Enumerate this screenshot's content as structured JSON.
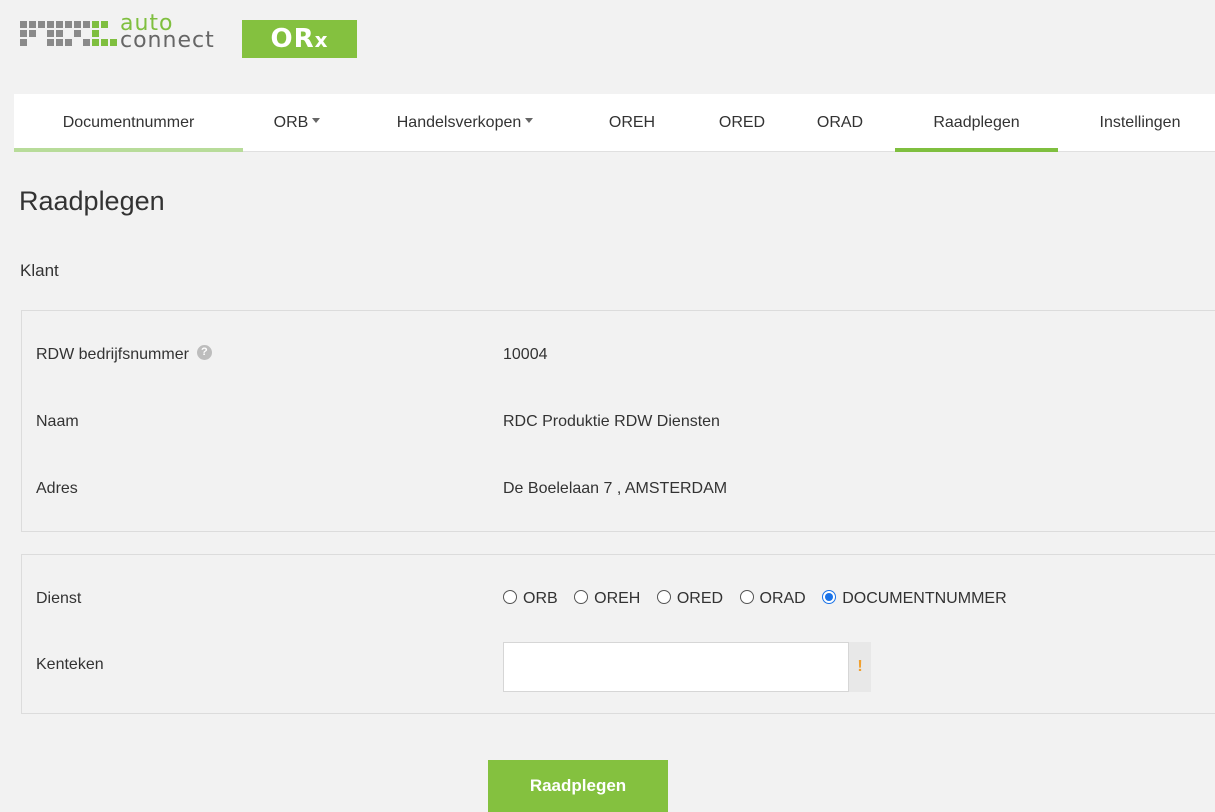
{
  "brand": {
    "logo_line1": "auto",
    "logo_line2": "connect",
    "badge_main": "OR",
    "badge_sub": "x",
    "accent_color": "#84c13f"
  },
  "nav": {
    "items": [
      {
        "label": "Documentnummer",
        "dropdown": false
      },
      {
        "label": "ORB",
        "dropdown": true
      },
      {
        "label": "Handelsverkopen",
        "dropdown": true
      },
      {
        "label": "OREH",
        "dropdown": false
      },
      {
        "label": "ORED",
        "dropdown": false
      },
      {
        "label": "ORAD",
        "dropdown": false
      },
      {
        "label": "Raadplegen",
        "dropdown": false,
        "active": true
      },
      {
        "label": "Instellingen",
        "dropdown": false
      }
    ]
  },
  "page": {
    "title": "Raadplegen",
    "section_title": "Klant"
  },
  "klant": {
    "rdw_label": "RDW bedrijfsnummer",
    "rdw_help_icon": "question-circle-icon",
    "rdw_value": "10004",
    "naam_label": "Naam",
    "naam_value": "RDC Produktie RDW Diensten",
    "adres_label": "Adres",
    "adres_value": "De Boelelaan 7 , AMSTERDAM"
  },
  "form": {
    "dienst_label": "Dienst",
    "dienst_options": [
      "ORB",
      "OREH",
      "ORED",
      "ORAD",
      "DOCUMENTNUMMER"
    ],
    "dienst_selected": "DOCUMENTNUMMER",
    "kenteken_label": "Kenteken",
    "kenteken_value": "",
    "required_marker": "!",
    "submit_label": "Raadplegen"
  }
}
